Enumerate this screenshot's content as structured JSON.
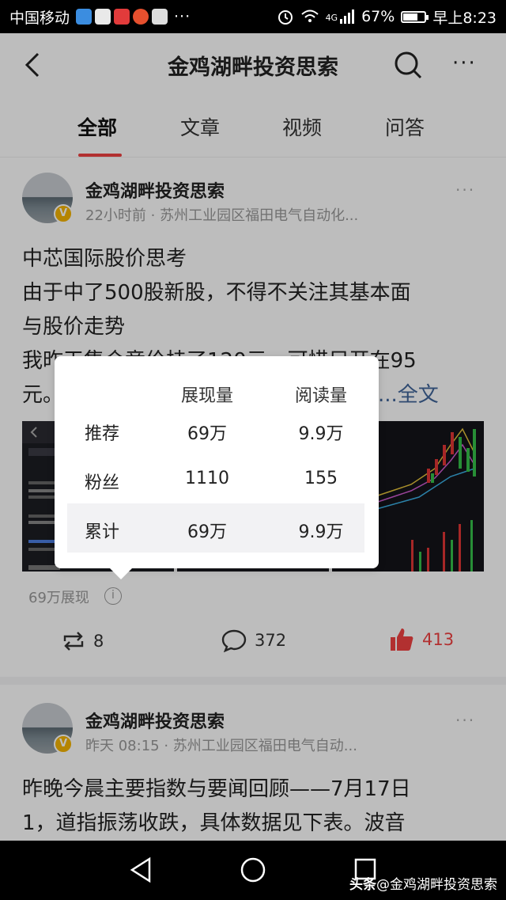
{
  "status_bar": {
    "carrier": "中国移动",
    "dots": "···",
    "network": "4G",
    "battery": "67%",
    "battery_fraction": 0.67,
    "time": "早上8:23"
  },
  "header": {
    "title": "金鸡湖畔投资思索",
    "back_icon": "back-arrow-icon",
    "search_icon": "search-icon",
    "more_icon": "more-icon",
    "more_label": "···"
  },
  "tabs": [
    {
      "label": "全部",
      "active": true
    },
    {
      "label": "文章",
      "active": false
    },
    {
      "label": "视频",
      "active": false
    },
    {
      "label": "问答",
      "active": false
    }
  ],
  "posts": [
    {
      "author": "金鸡湖畔投资思索",
      "verified": "V",
      "meta": "22小时前 · 苏州工业园区福田电气自动化...",
      "more": "···",
      "content_lines": [
        "中芯国际股价思考",
        "由于中了500股新股，不得不关注其基本面",
        "与股价走势",
        "我昨天集合竞价挂了120元，可惜只开在95",
        "元。"
      ],
      "full_text_link": "...全文",
      "impression": "69万展现",
      "repost_count": "8",
      "comment_count": "372",
      "like_count": "413"
    },
    {
      "author": "金鸡湖畔投资思索",
      "verified": "V",
      "meta": "昨天  08:15 · 苏州工业园区福田电气自动...",
      "more": "···",
      "content_lines": [
        "昨晚今晨主要指数与要闻回顾——7月17日",
        "1，道指振荡收跌，具体数据见下表。波音"
      ]
    }
  ],
  "stats_popover": {
    "headers": [
      "",
      "展现量",
      "阅读量"
    ],
    "rows": [
      {
        "label": "推荐",
        "impressions": "69万",
        "reads": "9.9万"
      },
      {
        "label": "粉丝",
        "impressions": "1110",
        "reads": "155"
      },
      {
        "label": "累计",
        "impressions": "69万",
        "reads": "9.9万"
      }
    ]
  },
  "nav_bar": {
    "back_icon": "triangle-back-icon",
    "home_icon": "circle-home-icon",
    "recent_icon": "square-recent-icon"
  },
  "watermark": {
    "app": "头条",
    "handle": "@金鸡湖畔投资思索"
  },
  "colors": {
    "accent": "#f04142",
    "link": "#406599",
    "verified": "#f5b400"
  }
}
